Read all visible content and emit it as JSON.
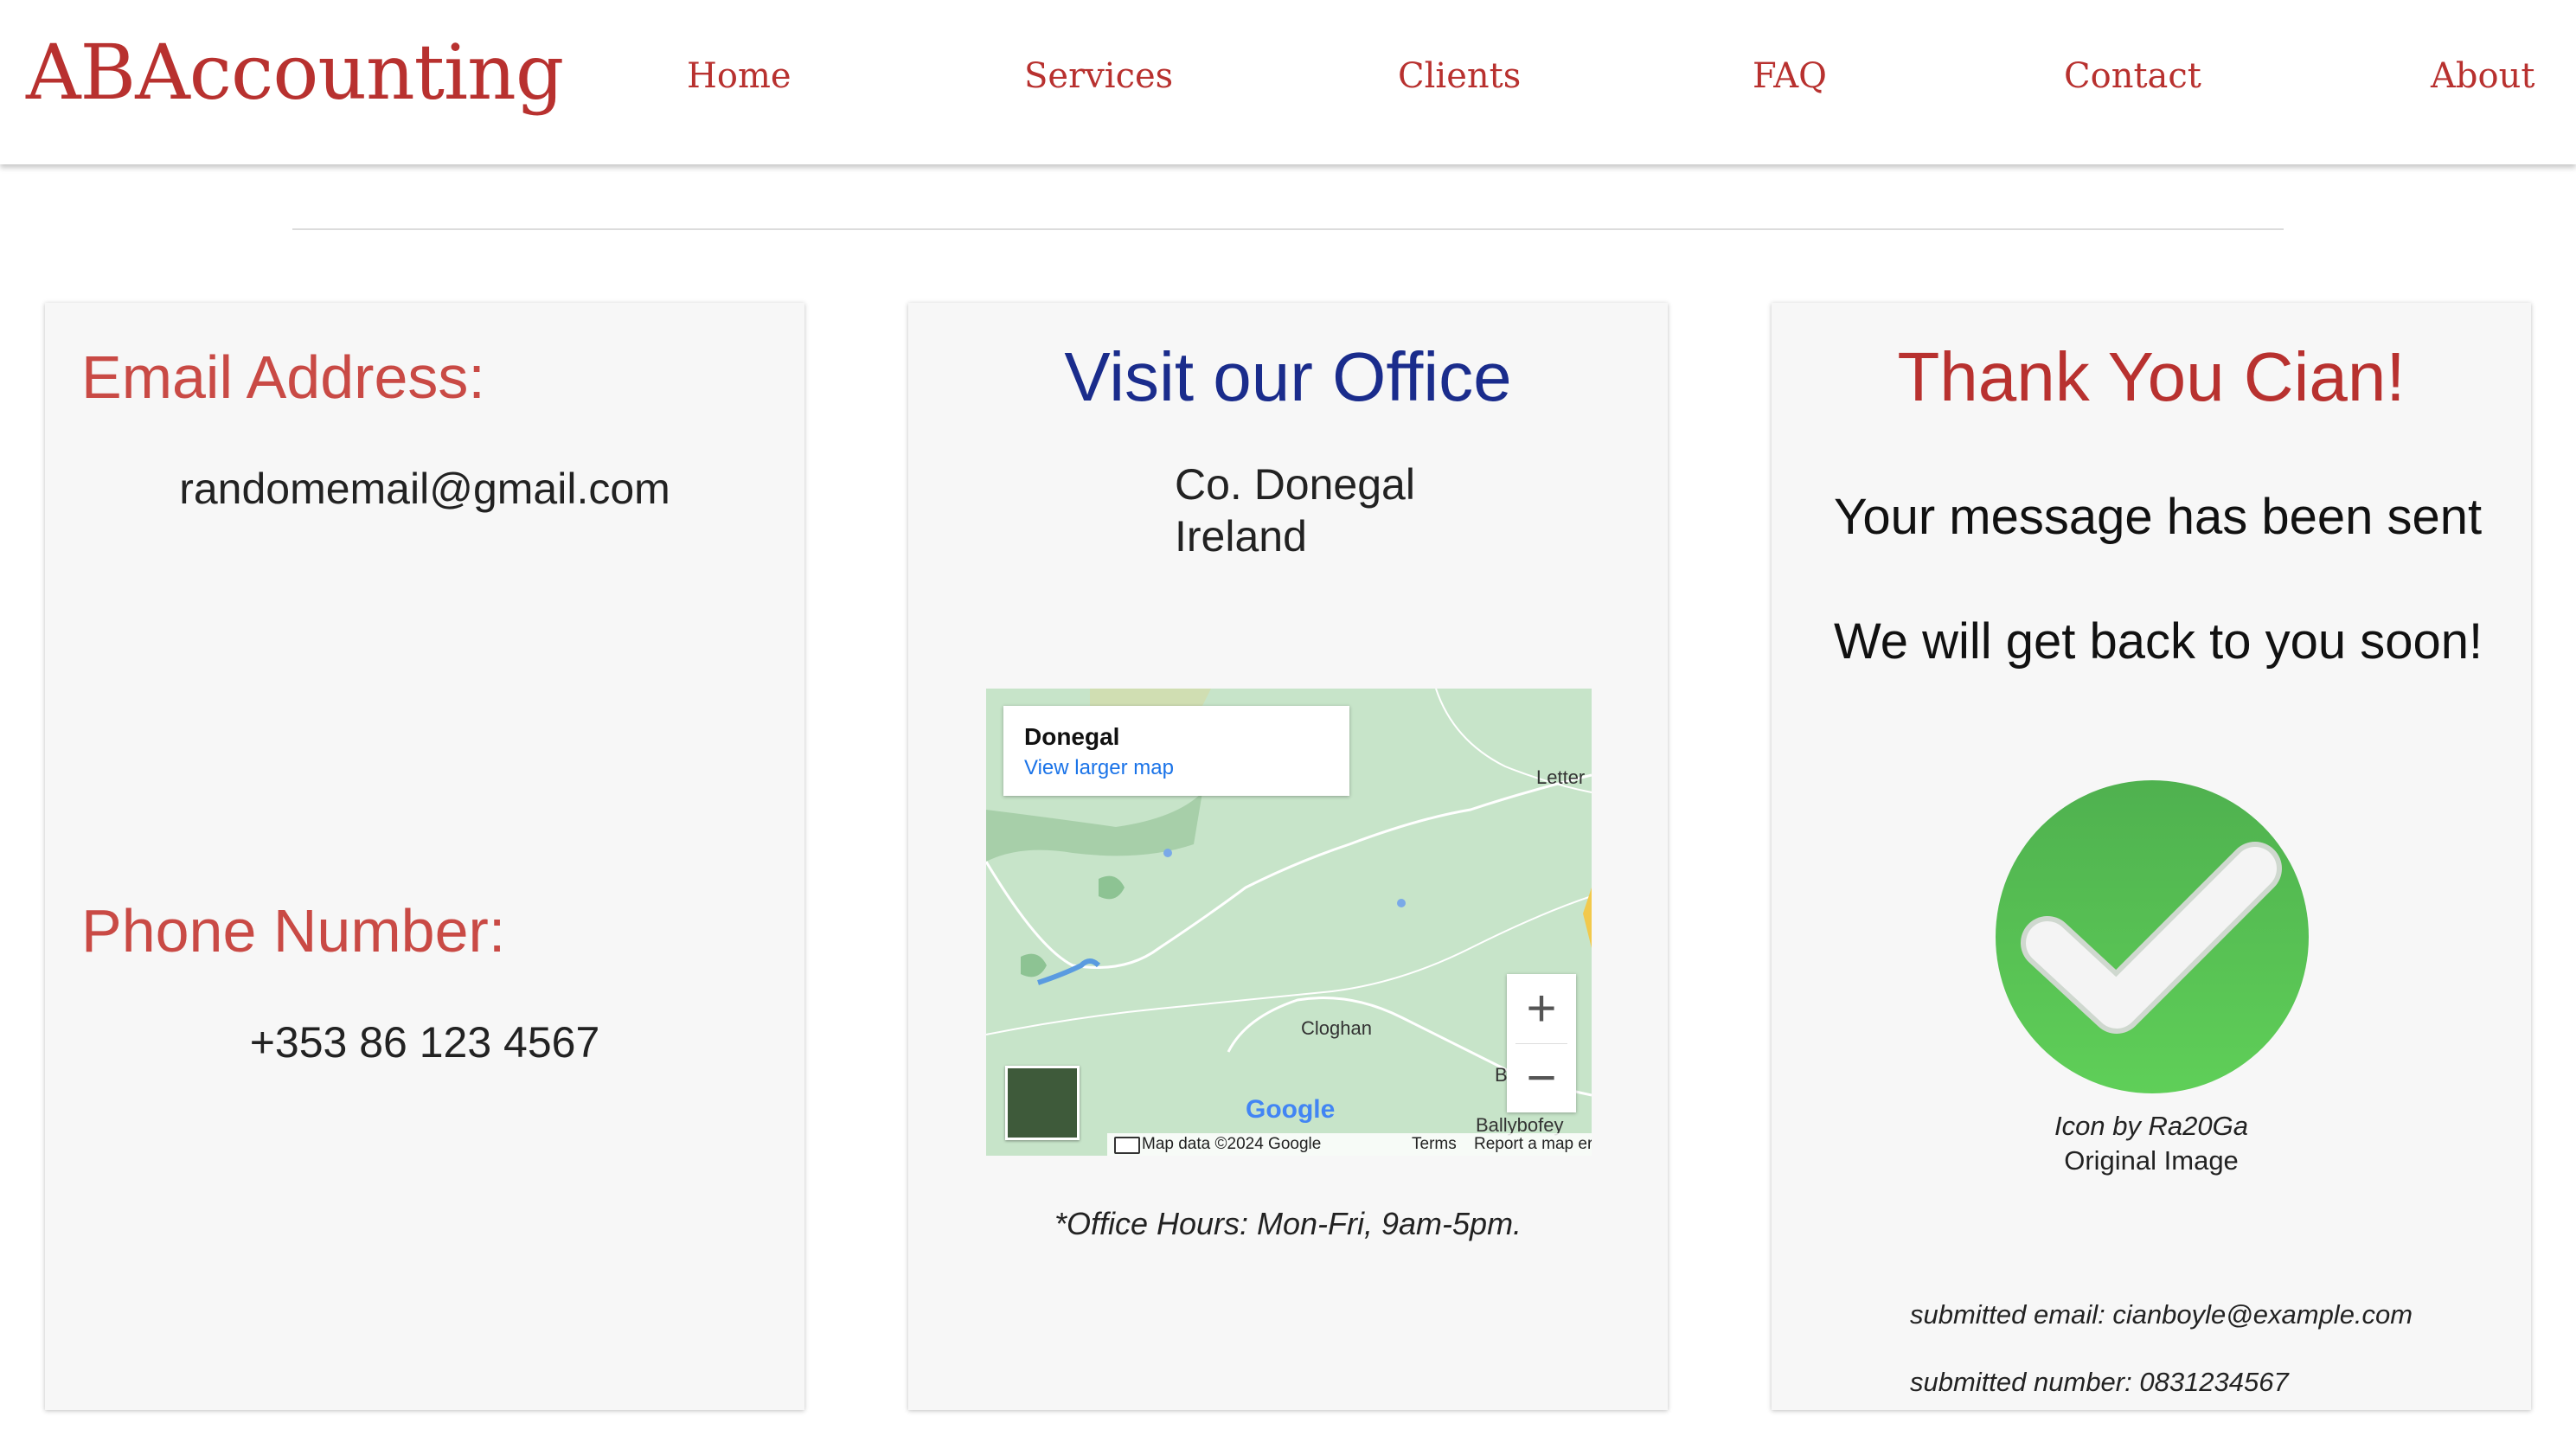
{
  "header": {
    "logo": "ABAccounting",
    "nav": [
      {
        "label": "Home"
      },
      {
        "label": "Services"
      },
      {
        "label": "Clients"
      },
      {
        "label": "FAQ"
      },
      {
        "label": "Contact"
      },
      {
        "label": "About"
      }
    ]
  },
  "contact": {
    "email_label": "Email Address:",
    "email_value": "randomemail@gmail.com",
    "phone_label": "Phone Number:",
    "phone_value": "+353 86 123 4567"
  },
  "office": {
    "title": "Visit our Office",
    "address_line1": "Co. Donegal",
    "address_line2": "Ireland",
    "map": {
      "place": "Donegal",
      "view_larger": "View larger map",
      "towns": [
        "Letter",
        "Cloghan",
        "B",
        "Ballybofey"
      ],
      "zoom_in": "+",
      "zoom_out": "−",
      "google_logo": "Google",
      "map_data": "Map data ©2024 Google",
      "terms": "Terms",
      "report": "Report a map error"
    },
    "hours": "*Office Hours: Mon-Fri, 9am-5pm."
  },
  "confirmation": {
    "title": "Thank You Cian!",
    "message1": "Your message has been sent",
    "message2": "We will get back to you soon!",
    "icon": "check-circle-icon",
    "icon_credit": "Icon by Ra20Ga",
    "icon_credit_link": "Original Image",
    "submitted_email": "submitted email: cianboyle@example.com",
    "submitted_number": "submitted number: 0831234567"
  },
  "colors": {
    "brand_red": "#b8312f",
    "office_blue": "#1a2c8c",
    "check_green": "#4cb94c"
  }
}
